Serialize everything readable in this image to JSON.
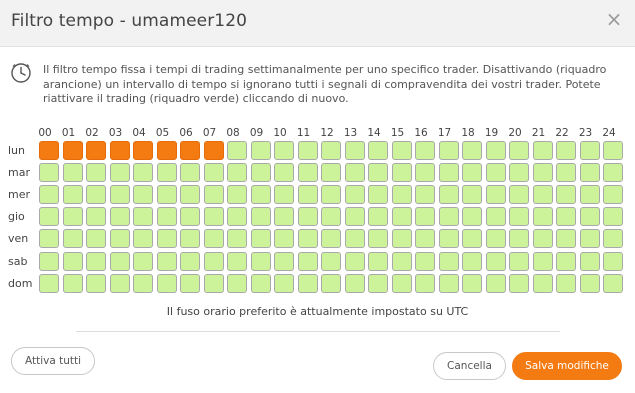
{
  "dialog": {
    "title": "Filtro tempo - umameer120",
    "description": "Il filtro tempo fissa i tempi di trading settimanalmente per uno specifico trader. Disattivando (riquadro arancione) un intervallo di tempo si ignorano tutti i segnali di compravendita dei vostri trader. Potete riattivare il trading (riquadro verde) cliccando di nuovo.",
    "close_icon": "×",
    "timezone_note": "Il fuso orario preferito è attualmente impostato su UTC"
  },
  "grid": {
    "hours": [
      "00",
      "01",
      "02",
      "03",
      "04",
      "05",
      "06",
      "07",
      "08",
      "09",
      "10",
      "11",
      "12",
      "13",
      "14",
      "15",
      "16",
      "17",
      "18",
      "19",
      "20",
      "21",
      "22",
      "23",
      "24"
    ],
    "days": [
      "lun",
      "mar",
      "mer",
      "gio",
      "ven",
      "sab",
      "dom"
    ],
    "disabled": {
      "lun": [
        0,
        1,
        2,
        3,
        4,
        5,
        6,
        7
      ]
    },
    "colors": {
      "enabled": "#ccf39a",
      "disabled": "#f47a12"
    }
  },
  "buttons": {
    "enable_all": "Attiva tutti",
    "cancel": "Cancella",
    "save": "Salva modifiche"
  },
  "colors": {
    "accent": "#f47a12",
    "header_bg": "#f2f2f2"
  }
}
